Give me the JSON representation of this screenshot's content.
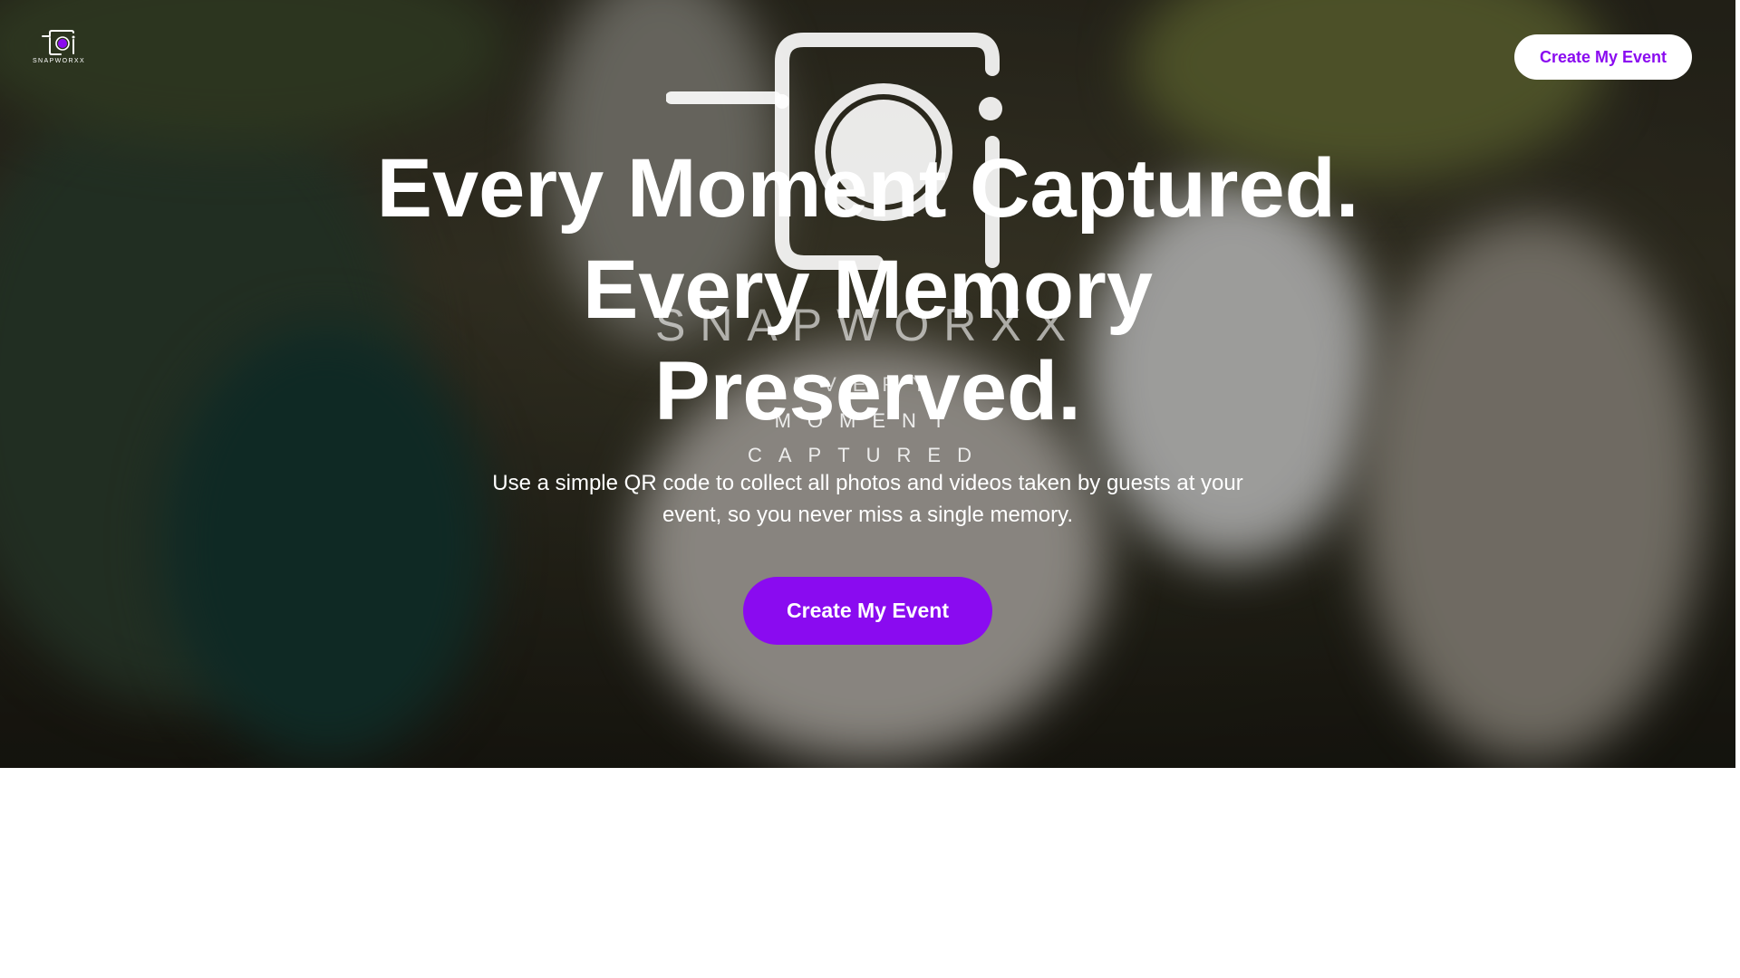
{
  "header": {
    "logo_text": "SNAPWORXX",
    "cta_label": "Create My Event"
  },
  "hero": {
    "headline_line1": "Every Moment Captured.",
    "headline_line2": "Every Memory",
    "headline_line3": "Preserved.",
    "subtitle": "Use a simple QR code to collect all photos and videos taken by guests at your event, so you never miss a single memory.",
    "cta_label": "Create My Event",
    "watermark": {
      "brand": "SNAPWORXX",
      "line1": "EVERY",
      "line2": "MOMENT",
      "line3": "CAPTURED"
    }
  },
  "colors": {
    "accent": "#8a0bf0",
    "button_light": "#ffffff",
    "page_background": "#ffffff"
  },
  "icons": {
    "logo": "camera-icon",
    "watermark": "camera-logo-icon"
  }
}
